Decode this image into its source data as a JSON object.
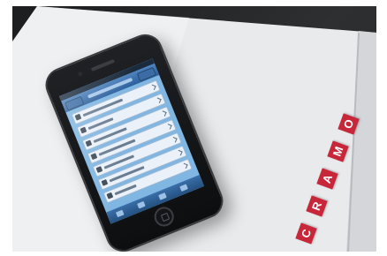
{
  "scene": {
    "folder_color": "#e9eaec",
    "background_color": "#2a2b2d",
    "tile_color": "#c8273a"
  },
  "brand": {
    "letters": [
      "C",
      "R",
      "A",
      "M",
      "O"
    ]
  },
  "phone": {
    "screen_rows": 7,
    "icons": [
      "apple-iphone",
      "home-button-icon"
    ]
  }
}
